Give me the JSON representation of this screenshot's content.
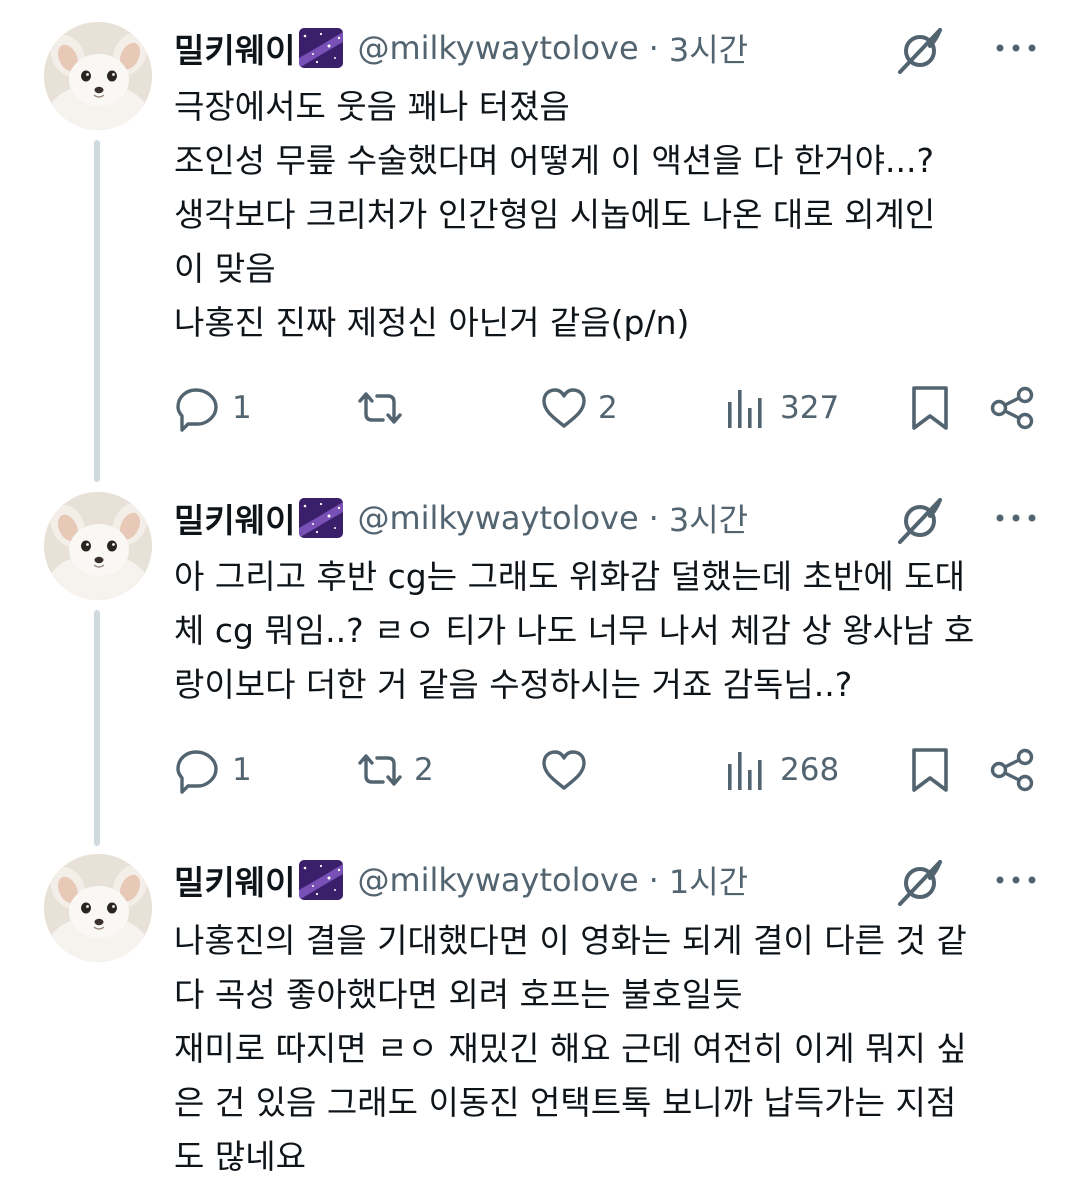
{
  "author": {
    "name": "밀키웨이",
    "handle": "@milkywaytolove"
  },
  "tweets": [
    {
      "time": "3시간",
      "lines": [
        "극장에서도 웃음 꽤나 터졌음",
        "조인성 무릎 수술했다며 어떻게 이 액션을 다 한거야...?",
        "생각보다 크리처가 인간형임 시놉에도 나온 대로 외계인",
        "이 맞음",
        "나홍진 진짜 제정신 아닌거 같음(p/n)"
      ],
      "reply_count": "1",
      "repost_count": "",
      "like_count": "2",
      "view_count": "327"
    },
    {
      "time": "3시간",
      "lines": [
        "아 그리고 후반 cg는 그래도 위화감 덜했는데 초반에 도대",
        "체 cg 뭐임..? ㄹㅇ 티가 나도 너무 나서 체감 상 왕사남 호",
        "랑이보다 더한 거 같음 수정하시는 거죠 감독님..?"
      ],
      "reply_count": "1",
      "repost_count": "2",
      "like_count": "",
      "view_count": "268"
    },
    {
      "time": "1시간",
      "lines": [
        "나홍진의 결을 기대했다면 이 영화는 되게 결이 다른 것 같",
        "다 곡성 좋아했다면 외려 호프는 불호일듯",
        "재미로 따지면 ㄹㅇ 재밌긴 해요 근데 여전히 이게 뭐지 싶",
        "은 건 있음 그래도 이동진 언택트톡 보니까 납득가는 지점",
        "도 많네요"
      ]
    }
  ],
  "icons": {
    "reply": "reply-bubble-icon",
    "repost": "repost-icon",
    "like": "heart-icon",
    "views": "views-bar-chart-icon",
    "bookmark": "bookmark-icon",
    "share": "share-icon",
    "grok": "grok-icon",
    "more": "more-dots-icon",
    "name_emoji": "milky-way-emoji"
  },
  "colors": {
    "text": "#0f1419",
    "secondary": "#536471",
    "thread_line": "#cfd9de",
    "emoji_bg": "#3a1f6b"
  }
}
